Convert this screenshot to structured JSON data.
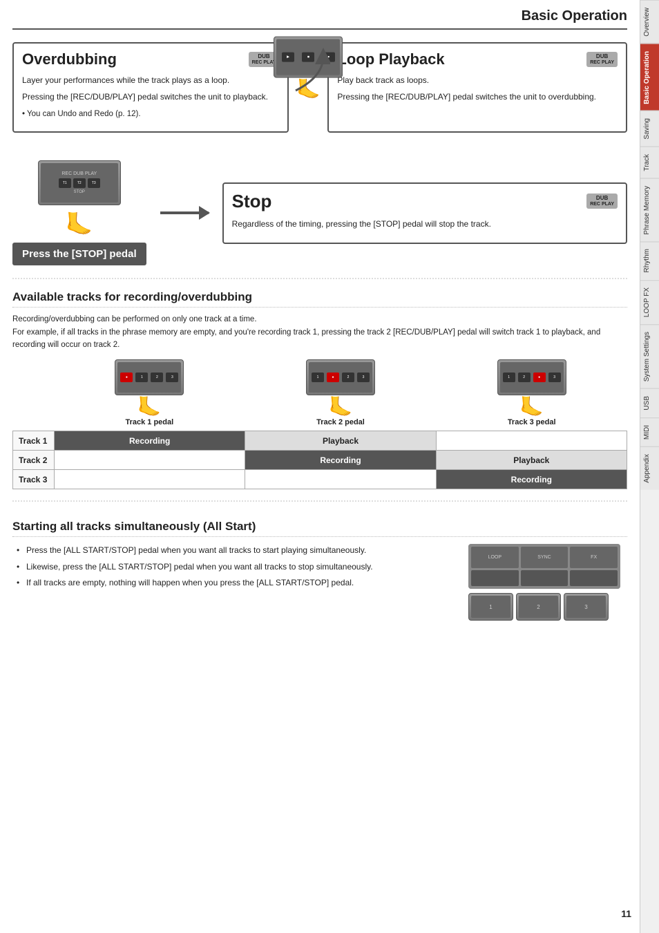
{
  "page": {
    "title": "Basic Operation",
    "page_number": "11"
  },
  "sidebar_tabs": [
    {
      "label": "Overview",
      "active": false
    },
    {
      "label": "Basic Operation",
      "active": true
    },
    {
      "label": "Saving",
      "active": false
    },
    {
      "label": "Track",
      "active": false
    },
    {
      "label": "Phrase Memory",
      "active": false
    },
    {
      "label": "Rhythm",
      "active": false
    },
    {
      "label": "LOOP FX",
      "active": false
    },
    {
      "label": "System Settings",
      "active": false
    },
    {
      "label": "USB",
      "active": false
    },
    {
      "label": "MIDI",
      "active": false
    },
    {
      "label": "Appendix",
      "active": false
    }
  ],
  "overdubbing": {
    "title": "Overdubbing",
    "badge": "DUB REC PLAY",
    "line1": "Layer your performances while the track plays as a loop.",
    "line2": "Pressing the [REC/DUB/PLAY] pedal switches the unit to playback.",
    "note": "• You can Undo and Redo (p. 12)."
  },
  "loop_playback": {
    "title": "Loop Playback",
    "badge": "DUB REC PLAY",
    "line1": "Play back track as loops.",
    "line2": "Pressing the [REC/DUB/PLAY] pedal switches the unit to overdubbing."
  },
  "stop_section": {
    "press_label": "Press the [STOP] pedal",
    "title": "Stop",
    "badge": "DUB REC PLAY",
    "description": "Regardless of the timing, pressing the [STOP] pedal will stop the track."
  },
  "available_tracks": {
    "title": "Available tracks for recording/overdubbing",
    "line1": "Recording/overdubbing can be performed on only one track at a time.",
    "line2": "For example, if all tracks in the phrase memory are empty, and you're recording track 1, pressing the track 2 [REC/DUB/PLAY] pedal will switch track 1 to playback, and recording will occur on track 2.",
    "pedal_labels": [
      "Track 1 pedal",
      "Track 2 pedal",
      "Track 3 pedal"
    ],
    "rows": [
      {
        "label": "Track 1",
        "cols": [
          "Recording",
          "Playback",
          ""
        ]
      },
      {
        "label": "Track 2",
        "cols": [
          "",
          "Recording",
          "Playback"
        ]
      },
      {
        "label": "Track 3",
        "cols": [
          "",
          "",
          "Recording"
        ]
      }
    ]
  },
  "all_start": {
    "title": "Starting all tracks simultaneously (All Start)",
    "bullets": [
      "Press the [ALL START/STOP] pedal when you want all tracks to start playing simultaneously.",
      "Likewise, press the [ALL START/STOP] pedal when you want all tracks to stop simultaneously.",
      "If all tracks are empty, nothing will happen when you press the [ALL START/STOP] pedal."
    ]
  }
}
